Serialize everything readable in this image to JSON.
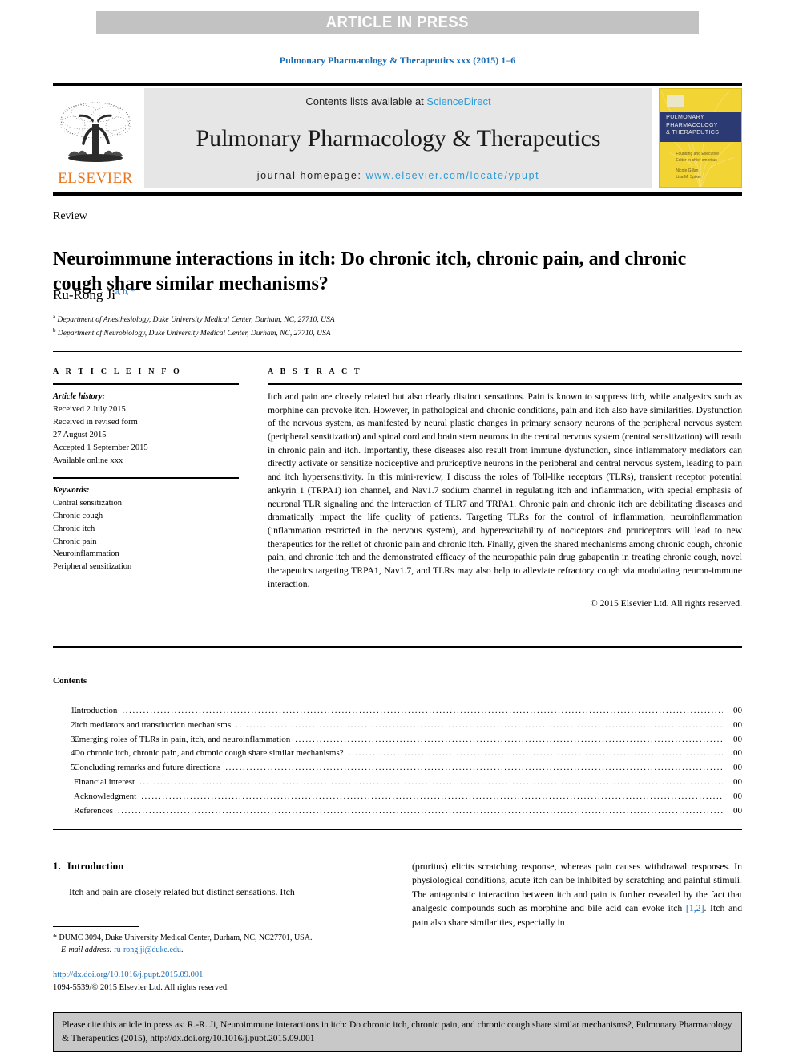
{
  "banner": {
    "text": "ARTICLE IN PRESS"
  },
  "journal_ref": "Pulmonary Pharmacology & Therapeutics xxx (2015) 1–6",
  "masthead": {
    "publisher": "ELSEVIER",
    "contents_prefix": "Contents lists available at ",
    "sciencedirect": "ScienceDirect",
    "journal_title": "Pulmonary Pharmacology & Therapeutics",
    "homepage_prefix": "journal homepage: ",
    "homepage_url": "www.elsevier.com/locate/ypupt",
    "cover_title_line1": "PULMONARY",
    "cover_title_line2": "PHARMACOLOGY",
    "cover_title_line3": "& THERAPEUTICS",
    "cover_footer_line1": "Founding and Executive",
    "cover_footer_line2": "Editor-in-chief emeritus",
    "cover_footer_line3": "Nicole Gillan",
    "cover_footer_line4": "Lisa M. Spiker"
  },
  "article": {
    "type": "Review",
    "title": "Neuroimmune interactions in itch: Do chronic itch, chronic pain, and chronic cough share similar mechanisms?",
    "author": "Ru-Rong Ji",
    "author_marks": "a, b, *",
    "affiliation_a_mark": "a",
    "affiliation_a": "Department of Anesthesiology, Duke University Medical Center, Durham, NC, 27710, USA",
    "affiliation_b_mark": "b",
    "affiliation_b": "Department of Neurobiology, Duke University Medical Center, Durham, NC, 27710, USA"
  },
  "info": {
    "heading": "A R T I C L E   I N F O",
    "history_label": "Article history:",
    "history": [
      "Received 2 July 2015",
      "Received in revised form",
      "27 August 2015",
      "Accepted 1 September 2015",
      "Available online xxx"
    ],
    "keywords_label": "Keywords:",
    "keywords": [
      "Central sensitization",
      "Chronic cough",
      "Chronic itch",
      "Chronic pain",
      "Neuroinflammation",
      "Peripheral sensitization"
    ]
  },
  "abstract": {
    "heading": "A B S T R A C T",
    "text": "Itch and pain are closely related but also clearly distinct sensations. Pain is known to suppress itch, while analgesics such as morphine can provoke itch. However, in pathological and chronic conditions, pain and itch also have similarities. Dysfunction of the nervous system, as manifested by neural plastic changes in primary sensory neurons of the peripheral nervous system (peripheral sensitization) and spinal cord and brain stem neurons in the central nervous system (central sensitization) will result in chronic pain and itch. Importantly, these diseases also result from immune dysfunction, since inflammatory mediators can directly activate or sensitize nociceptive and pruriceptive neurons in the peripheral and central nervous system, leading to pain and itch hypersensitivity. In this mini-review, I discuss the roles of Toll-like receptors (TLRs), transient receptor potential ankyrin 1 (TRPA1) ion channel, and Nav1.7 sodium channel in regulating itch and inflammation, with special emphasis of neuronal TLR signaling and the interaction of TLR7 and TRPA1. Chronic pain and chronic itch are debilitating diseases and dramatically impact the life quality of patients. Targeting TLRs for the control of inflammation, neuroinflammation (inflammation restricted in the nervous system), and hyperexcitability of nociceptors and pruriceptors will lead to new therapeutics for the relief of chronic pain and chronic itch. Finally, given the shared mechanisms among chronic cough, chronic pain, and chronic itch and the demonstrated efficacy of the neuropathic pain drug gabapentin in treating chronic cough, novel therapeutics targeting TRPA1, Nav1.7, and TLRs may also help to alleviate refractory cough via modulating neuron-immune interaction.",
    "copyright": "© 2015 Elsevier Ltd. All rights reserved."
  },
  "contents": {
    "heading": "Contents",
    "items": [
      {
        "num": "1.",
        "label": "Introduction",
        "page": "00"
      },
      {
        "num": "2.",
        "label": "Itch mediators and transduction mechanisms",
        "page": "00"
      },
      {
        "num": "3.",
        "label": "Emerging roles of TLRs in pain, itch, and neuroinflammation",
        "page": "00"
      },
      {
        "num": "4.",
        "label": "Do chronic itch, chronic pain, and chronic cough share similar mechanisms?",
        "page": "00"
      },
      {
        "num": "5.",
        "label": "Concluding remarks and future directions",
        "page": "00"
      },
      {
        "num": "",
        "label": "Financial interest",
        "page": "00"
      },
      {
        "num": "",
        "label": "Acknowledgment",
        "page": "00"
      },
      {
        "num": "",
        "label": "References",
        "page": "00"
      }
    ]
  },
  "body": {
    "section_number": "1.",
    "section_title": "Introduction",
    "left_paragraph": "Itch and pain are closely related but distinct sensations. Itch",
    "right_paragraph_1": "(pruritus) elicits scratching response, whereas pain causes withdrawal responses. In physiological conditions, acute itch can be inhibited by scratching and painful stimuli. The antagonistic interaction between itch and pain is further revealed by the fact that analgesic compounds such as morphine and bile acid can evoke itch ",
    "right_citation": "[1,2]",
    "right_paragraph_2": ". Itch and pain also share similarities, especially in"
  },
  "footnote": {
    "marker": "*",
    "address": "DUMC 3094, Duke University Medical Center, Durham, NC, NC27701, USA.",
    "email_label": "E-mail address:",
    "email": "ru-rong.ji@duke.edu",
    "email_period": ".",
    "doi": "http://dx.doi.org/10.1016/j.pupt.2015.09.001",
    "issn_line": "1094-5539/© 2015 Elsevier Ltd. All rights reserved."
  },
  "cite_box": {
    "text": "Please cite this article in press as: R.-R. Ji, Neuroimmune interactions in itch: Do chronic itch, chronic pain, and chronic cough share similar mechanisms?, Pulmonary Pharmacology & Therapeutics (2015), http://dx.doi.org/10.1016/j.pupt.2015.09.001"
  },
  "colors": {
    "link_blue": "#1a6cb3",
    "sciencedirect_blue": "#2e9bd6",
    "elsevier_orange": "#e87722",
    "banner_gray": "#c2c2c2",
    "masthead_gray": "#e6e6e6",
    "cover_yellow": "#f2d435",
    "cover_navy": "#2b3a72",
    "cite_box_gray": "#c8c8c8"
  }
}
